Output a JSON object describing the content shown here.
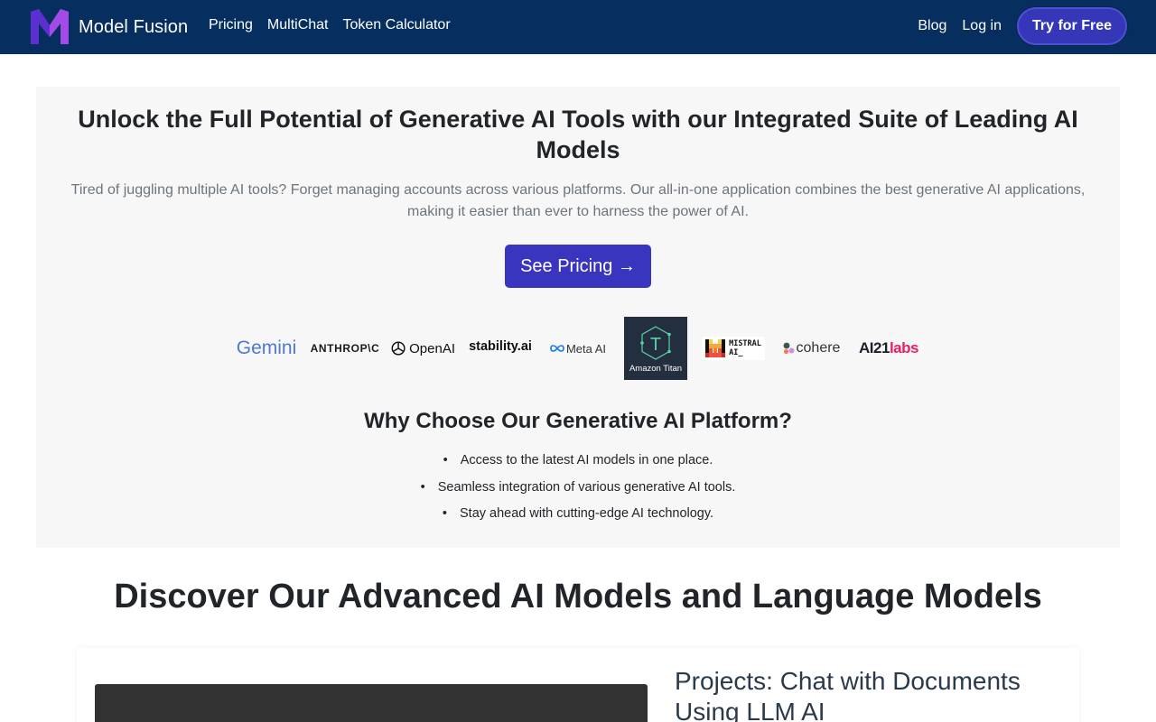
{
  "nav": {
    "brand": "Model Fusion",
    "links": [
      "Pricing",
      "MultiChat",
      "Token Calculator"
    ],
    "blog": "Blog",
    "login": "Log in",
    "cta": "Try for Free"
  },
  "hero": {
    "title": "Unlock the Full Potential of Generative AI Tools with our Integrated Suite of Leading AI Models",
    "subtitle": "Tired of juggling multiple AI tools? Forget managing accounts across various platforms. Our all-in-one application combines the best generative AI applications, making it easier than ever to harness the power of AI.",
    "cta": "See Pricing →"
  },
  "logos": {
    "gemini": "Gemini",
    "anthropic": "ANTHROP\\C",
    "openai": "OpenAI",
    "stability": "stability.ai",
    "meta": "Meta AI",
    "titan": "Amazon Titan",
    "mistral_line1": "MISTRAL",
    "mistral_line2": "AI_",
    "cohere": "cohere",
    "ai21_a": "AI21",
    "ai21_b": "labs"
  },
  "why": {
    "title": "Why Choose Our Generative AI Platform?",
    "items": [
      "Access to the latest AI models in one place.",
      "Seamless integration of various generative AI tools.",
      "Stay ahead with cutting-edge AI technology."
    ]
  },
  "discover": {
    "title": "Discover Our Advanced AI Models and Language Models",
    "card_title": "Projects: Chat with Documents Using LLM AI"
  },
  "colors": {
    "navbar": "#062f5f",
    "accent": "#3a35be",
    "hero_bg": "#f7f7f7"
  }
}
